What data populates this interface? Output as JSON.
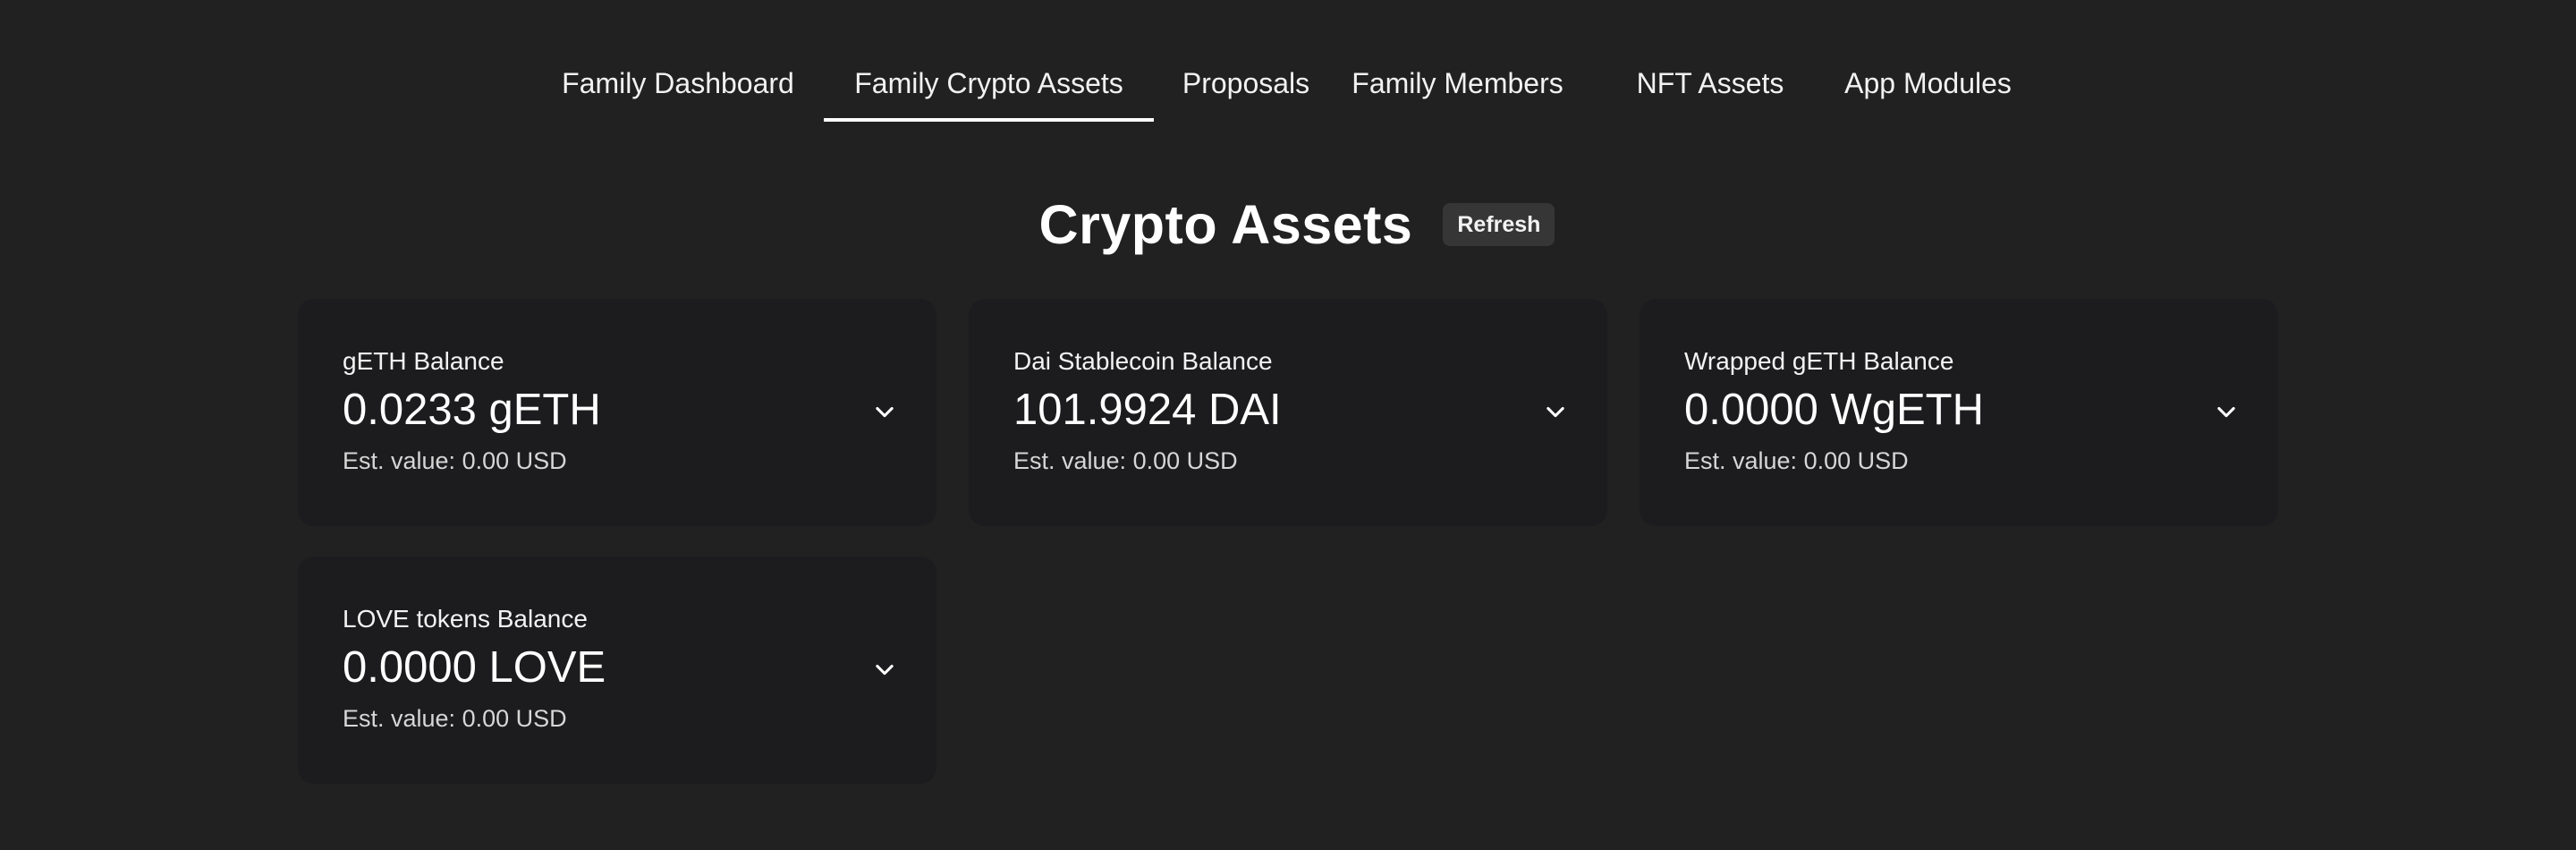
{
  "tabs": [
    {
      "label": "Family Dashboard",
      "active": false
    },
    {
      "label": "Family Crypto Assets",
      "active": true
    },
    {
      "label": "Proposals",
      "active": false
    },
    {
      "label": "Family Members",
      "active": false
    },
    {
      "label": "NFT Assets",
      "active": false
    },
    {
      "label": "App Modules",
      "active": false
    }
  ],
  "main": {
    "title": "Crypto Assets",
    "refresh_label": "Refresh"
  },
  "assets": [
    {
      "label": "gETH Balance",
      "amount": "0.0233 gETH",
      "est": "Est. value: 0.00 USD",
      "icon": "chevron-down-icon"
    },
    {
      "label": "Dai Stablecoin Balance",
      "amount": "101.9924 DAI",
      "est": "Est. value: 0.00 USD",
      "icon": "chevron-down-icon"
    },
    {
      "label": "Wrapped gETH Balance",
      "amount": "0.0000 WgETH",
      "est": "Est. value: 0.00 USD",
      "icon": "chevron-down-icon"
    },
    {
      "label": "LOVE tokens Balance",
      "amount": "0.0000 LOVE",
      "est": "Est. value: 0.00 USD",
      "icon": "chevron-down-icon"
    }
  ],
  "colors": {
    "background": "#212121",
    "card": "#1c1c1e",
    "refresh_button": "#363636",
    "text": "#ffffff"
  }
}
